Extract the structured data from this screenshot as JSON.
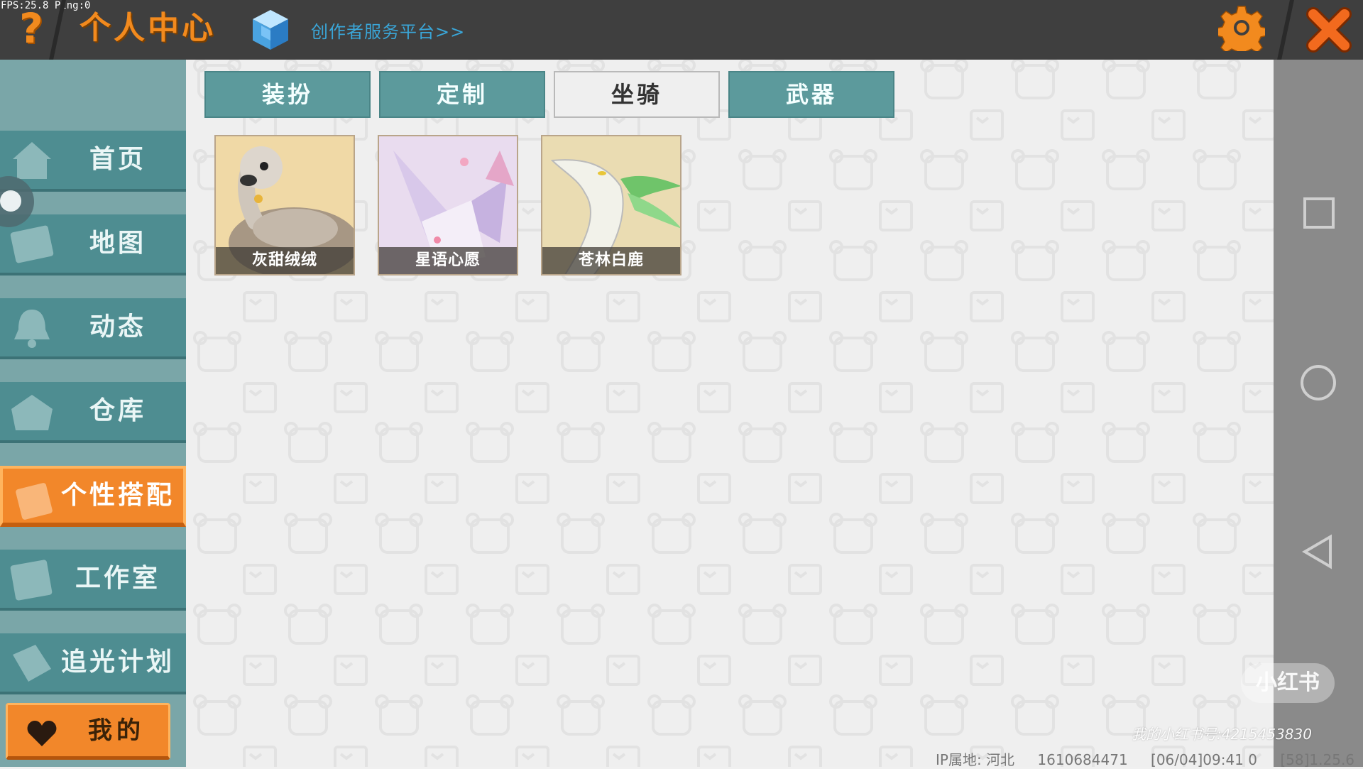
{
  "status": {
    "fps": "FPS:25.8",
    "ping": "Ping:0"
  },
  "header": {
    "title": "个人中心",
    "creator_link": "创作者服务平台>>",
    "help_icon": "question-mark-icon",
    "settings_icon": "gear-icon",
    "close_icon": "close-icon",
    "accent_color": "#f28a1e"
  },
  "sidebar": {
    "items": [
      {
        "label": "首页",
        "icon": "house-icon"
      },
      {
        "label": "地图",
        "icon": "map-icon"
      },
      {
        "label": "动态",
        "icon": "bell-icon"
      },
      {
        "label": "仓库",
        "icon": "warehouse-icon"
      },
      {
        "label": "个性搭配",
        "icon": "wardrobe-icon",
        "active": true
      },
      {
        "label": "工作室",
        "icon": "studio-tree-icon"
      },
      {
        "label": "追光计划",
        "icon": "tag-icon"
      }
    ],
    "mine_button": {
      "label": "我的",
      "icon": "heart-icon"
    }
  },
  "tabs": [
    {
      "label": "装扮"
    },
    {
      "label": "定制"
    },
    {
      "label": "坐骑",
      "active": true
    },
    {
      "label": "武器"
    }
  ],
  "mounts": [
    {
      "name": "灰甜绒绒"
    },
    {
      "name": "星语心愿"
    },
    {
      "name": "苍林白鹿"
    }
  ],
  "overlay": {
    "watermark": "小红书",
    "redbook_id": "我的小红书号:4215453830",
    "ip_location": "IP属地: 河北",
    "user_id": "1610684471",
    "timestamp": "[06/04]09:41 0",
    "version": "[58]1.25.6"
  },
  "colors": {
    "teal": "#4e8d91",
    "orange_active": "#f2872a",
    "creator_link": "#3aa6d8"
  }
}
